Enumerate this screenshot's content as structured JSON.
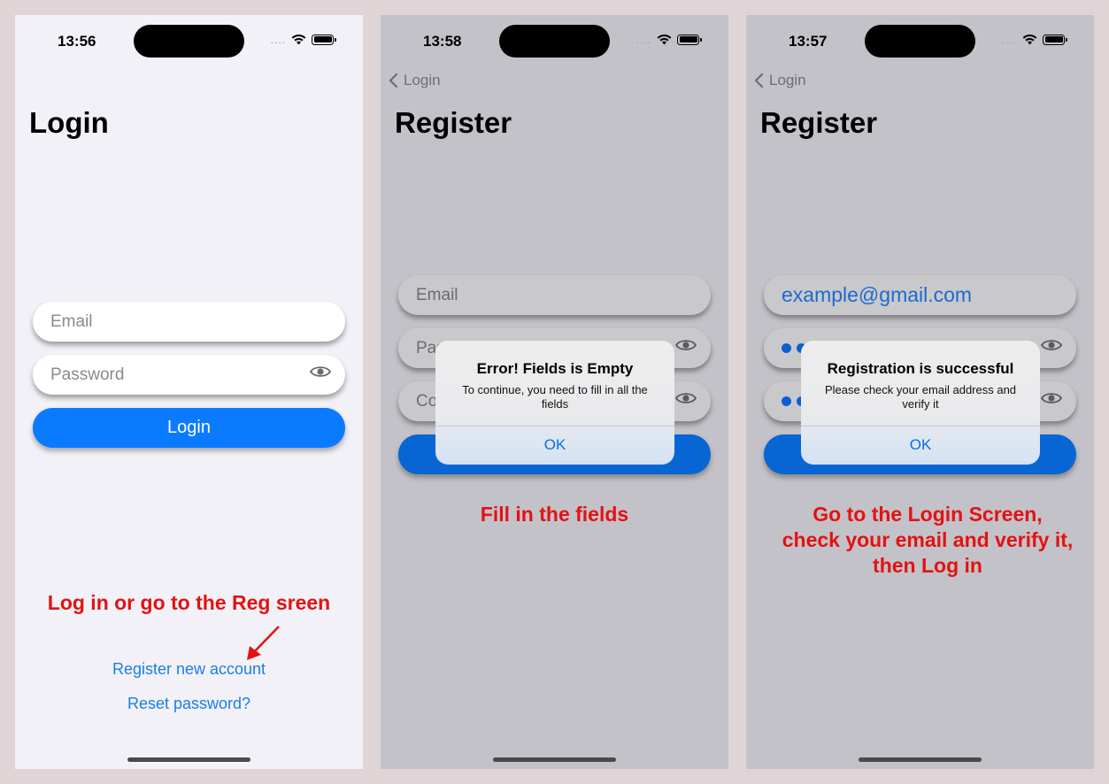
{
  "status": {
    "screen1_time": "13:56",
    "screen2_time": "13:58",
    "screen3_time": "13:57",
    "signal_dots": "....",
    "icons": [
      "wifi-icon",
      "battery-icon"
    ]
  },
  "login_screen": {
    "title": "Login",
    "email_placeholder": "Email",
    "password_placeholder": "Password",
    "login_button": "Login",
    "annotation": "Log in or go to the Reg sreen",
    "register_link": "Register new account",
    "reset_link": "Reset password?"
  },
  "register_screen_error": {
    "back_label": "Login",
    "title": "Register",
    "email_placeholder": "Email",
    "password_partial": "Pas",
    "confirm_partial": "Co",
    "alert": {
      "title": "Error! Fields is Empty",
      "message": "To continue, you need to fill in all the fields",
      "ok": "OK"
    },
    "annotation": "Fill in the fields"
  },
  "register_screen_success": {
    "back_label": "Login",
    "title": "Register",
    "email_value": "example@gmail.com",
    "alert": {
      "title": "Registration is successful",
      "message": "Please check your email address and verify it",
      "ok": "OK"
    },
    "annotation_line1": "Go to the Login Screen,",
    "annotation_line2": "check your email and verify it,",
    "annotation_line3": "then Log in"
  },
  "colors": {
    "accent": "#0a7bff",
    "annotation": "#e31212",
    "link": "#1a7ee6",
    "background": "#e0d5d6"
  }
}
